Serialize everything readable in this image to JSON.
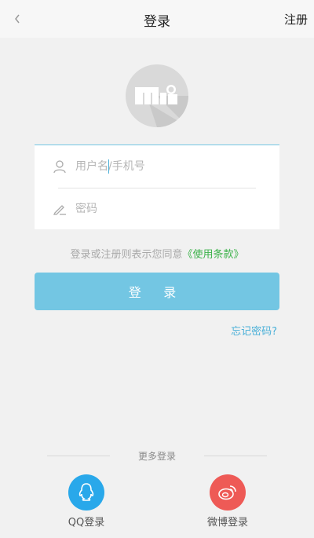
{
  "header": {
    "title": "登录",
    "register_label": "注册"
  },
  "form": {
    "username_placeholder": "用户名/手机号",
    "password_placeholder": "密码"
  },
  "terms": {
    "prefix": "登录或注册则表示您同意",
    "link": "《使用条款》"
  },
  "login_button_label": "登 录",
  "forgot_label": "忘记密码?",
  "more_login": {
    "title": "更多登录",
    "qq_label": "QQ登录",
    "weibo_label": "微博登录"
  },
  "colors": {
    "accent": "#73c6e3",
    "link_green": "#3cb24a",
    "qq": "#29a8ea",
    "weibo": "#ee5a56"
  },
  "icons": {
    "back": "chevron-left-icon",
    "user": "user-icon",
    "password": "pencil-icon",
    "qq": "qq-icon",
    "weibo": "weibo-icon"
  }
}
